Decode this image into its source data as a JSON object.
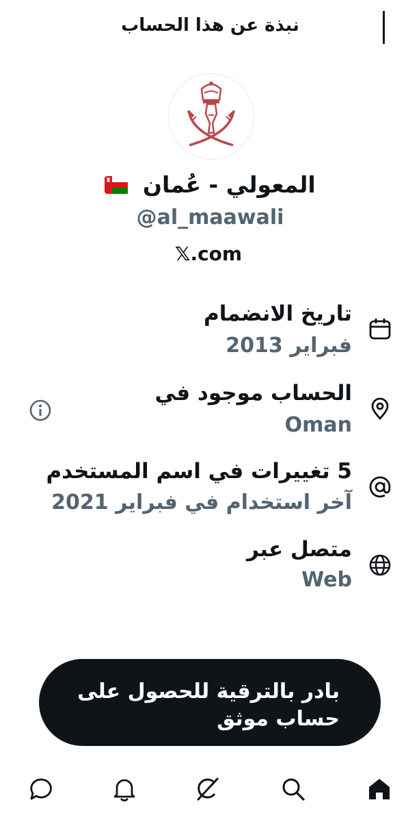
{
  "header": {
    "title": "نبذة عن هذا الحساب"
  },
  "profile": {
    "display_name": "المعولي - عُمان",
    "handle": "@al_maawali",
    "website": "𝕏.com",
    "flag_icon": "oman-flag-icon",
    "avatar_icon": "oman-emblem-icon"
  },
  "info": {
    "joined": {
      "label": "تاريخ الانضمام",
      "value": "فبراير 2013",
      "icon": "calendar-icon"
    },
    "location": {
      "label": "الحساب موجود في",
      "value": "Oman",
      "icon": "location-pin-icon",
      "info_icon": "info-icon"
    },
    "username_changes": {
      "label": "5 تغييرات في اسم المستخدم",
      "value": "آخر استخدام في فبراير 2021",
      "icon": "at-sign-icon"
    },
    "connected_via": {
      "label": "متصل عبر",
      "value": "Web",
      "icon": "globe-icon"
    }
  },
  "upgrade": {
    "line1": "بادر بالترقية للحصول على",
    "line2": "حساب موثق"
  },
  "nav": {
    "items": [
      "home-icon",
      "search-icon",
      "grok-icon",
      "notifications-icon",
      "messages-icon"
    ]
  },
  "colors": {
    "primary_text": "#0f1419",
    "secondary_text": "#536471",
    "button_bg": "#0f1419",
    "flag_red": "#db161b",
    "flag_green": "#008000",
    "emblem": "#b9474f"
  }
}
